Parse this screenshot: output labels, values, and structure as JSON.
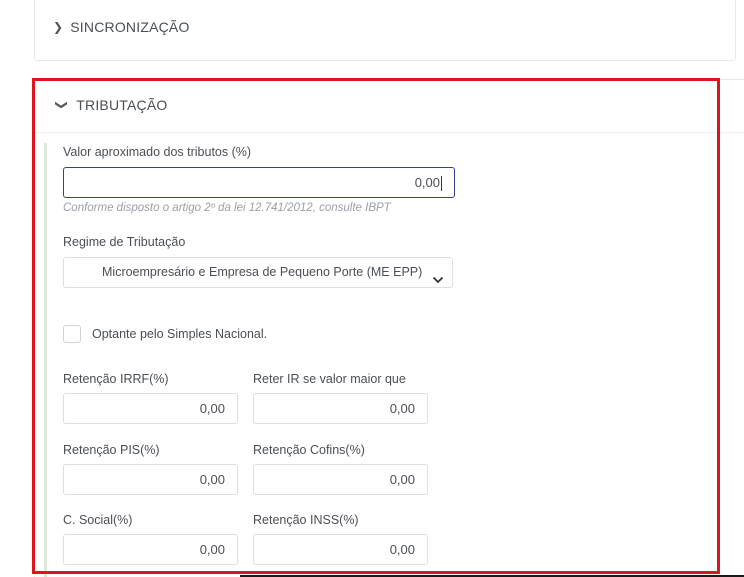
{
  "sync": {
    "title": "SINCRONIZAÇÃO"
  },
  "tributacao": {
    "title": "TRIBUTAÇÃO",
    "valor_aprox": {
      "label": "Valor aproximado dos tributos (%)",
      "value": "0,00",
      "hint_prefix": "Conforme disposto o artigo 2º da lei 12.741/2012, ",
      "hint_link": "consulte IBPT"
    },
    "regime": {
      "label": "Regime de Tributação",
      "selected": "Microempresário e Empresa de Pequeno Porte (ME EPP)"
    },
    "simples": {
      "label": "Optante pelo Simples Nacional.",
      "checked": false
    },
    "fields": {
      "irrf": {
        "label": "Retenção IRRF(%)",
        "value": "0,00"
      },
      "reter_ir": {
        "label": "Reter IR se valor maior que",
        "value": "0,00"
      },
      "pis": {
        "label": "Retenção PIS(%)",
        "value": "0,00"
      },
      "cofins": {
        "label": "Retenção Cofins(%)",
        "value": "0,00"
      },
      "csocial": {
        "label": "C. Social(%)",
        "value": "0,00"
      },
      "inss": {
        "label": "Retenção INSS(%)",
        "value": "0,00"
      }
    }
  },
  "colors": {
    "highlight": "#e0141c",
    "focus_border": "#3a3f8f"
  }
}
